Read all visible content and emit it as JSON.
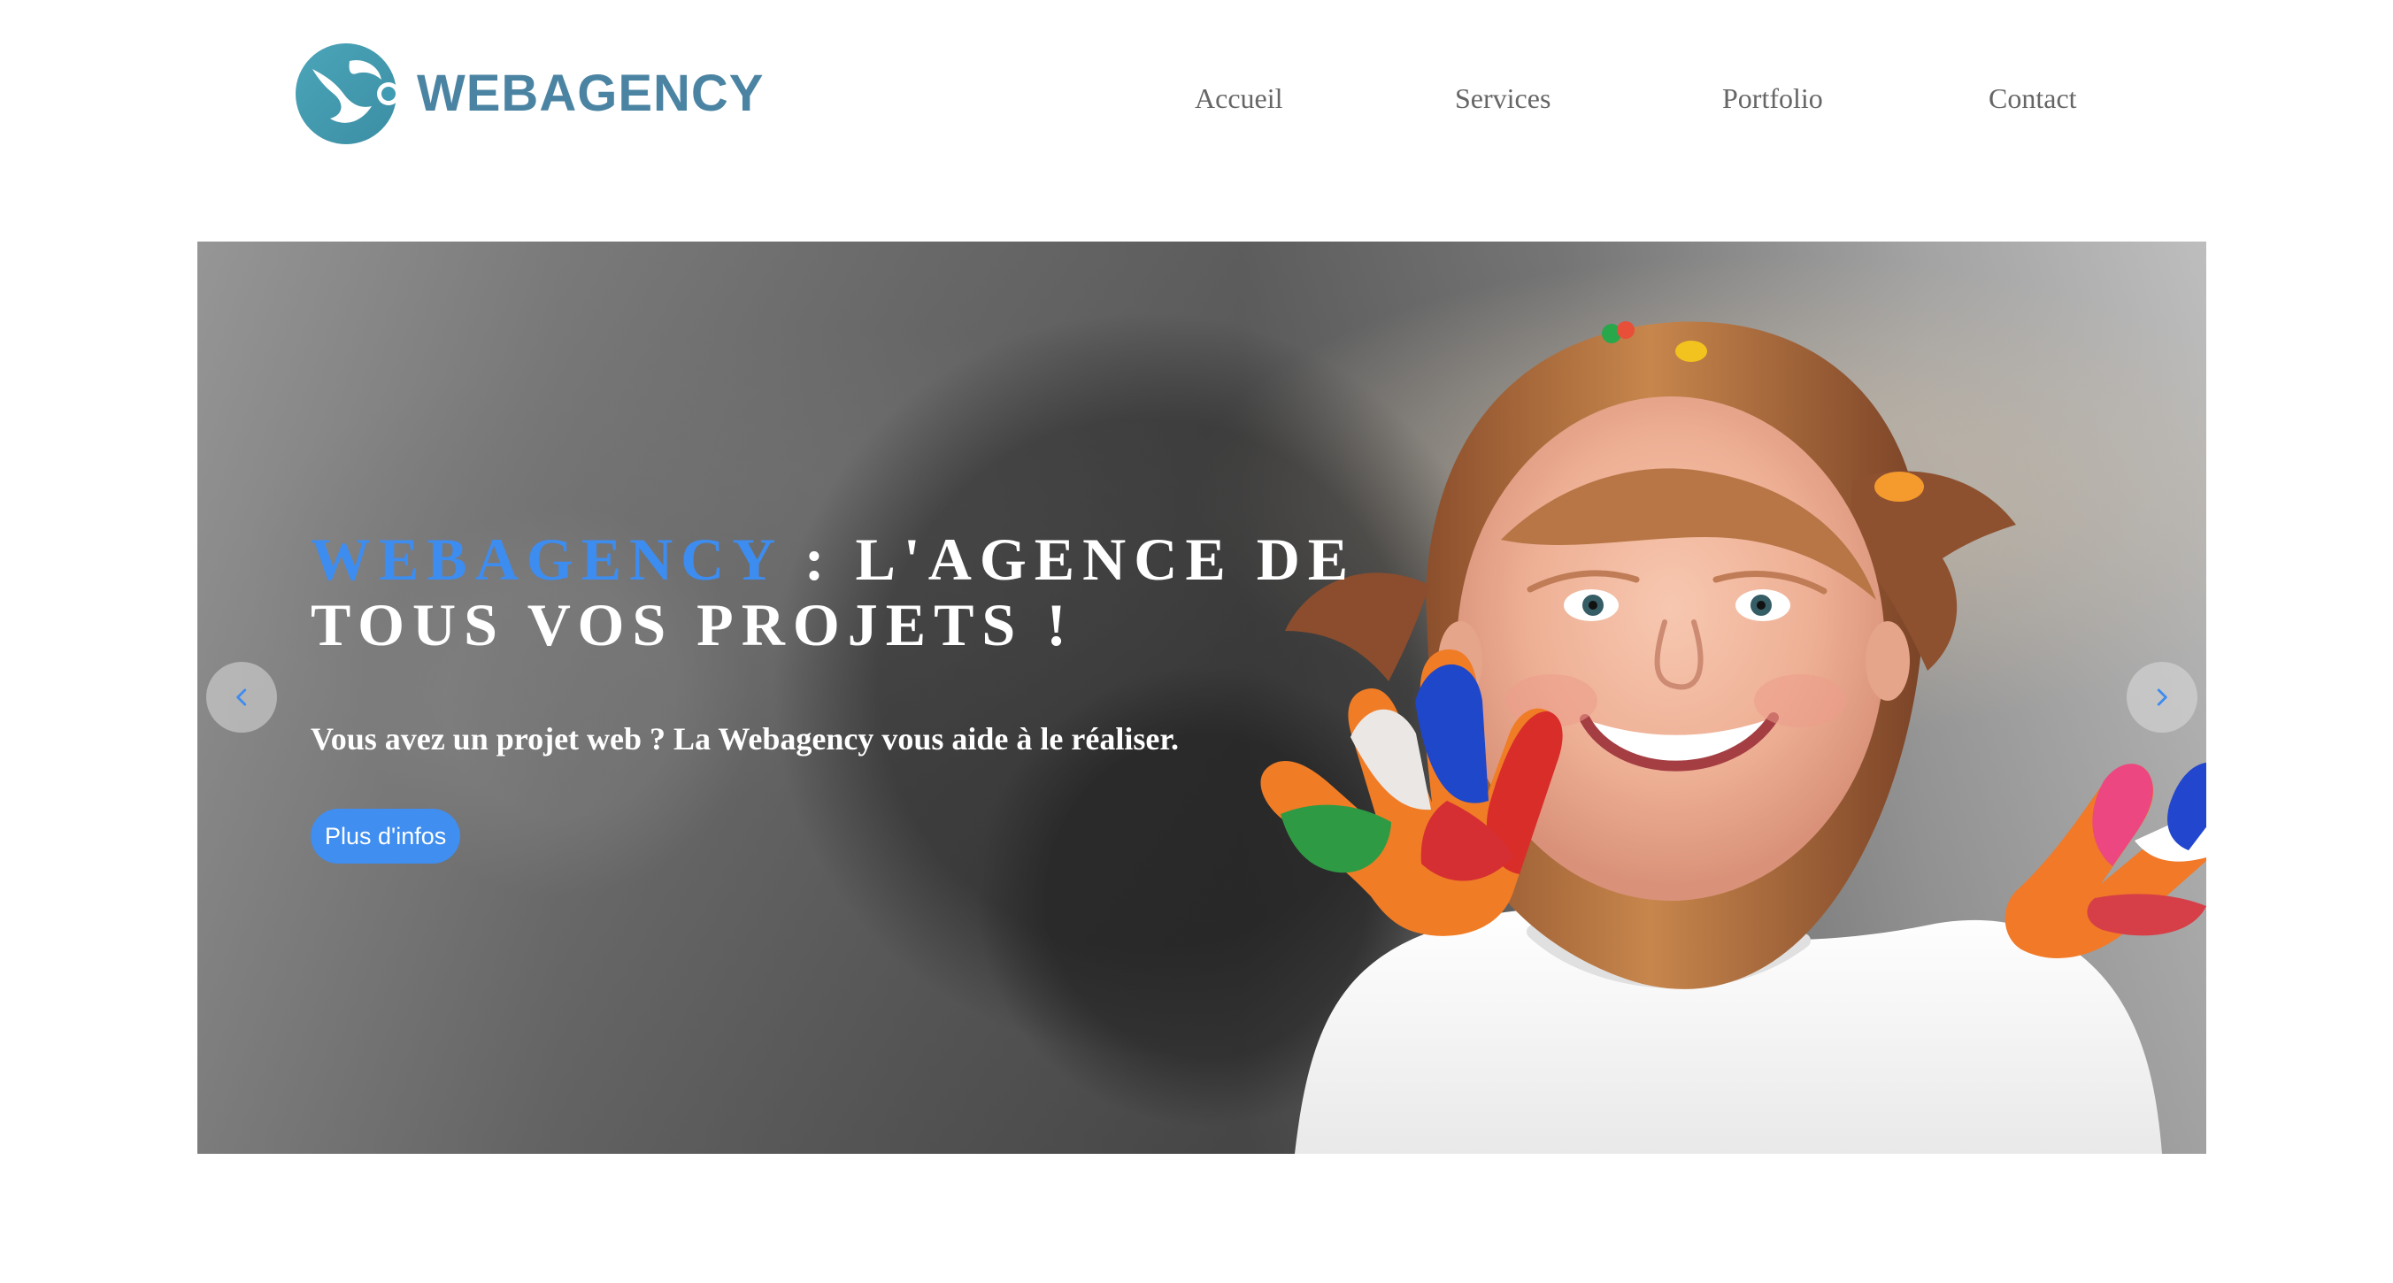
{
  "brand": {
    "name": "WEBAGENCY",
    "color": "#4b84a3"
  },
  "nav": {
    "items": [
      {
        "label": "Accueil"
      },
      {
        "label": "Services"
      },
      {
        "label": "Portfolio"
      },
      {
        "label": "Contact"
      }
    ]
  },
  "hero": {
    "title_accent": "WEBAGENCY",
    "title_rest": " : L'AGENCE DE TOUS VOS PROJETS !",
    "subtitle": "Vous avez un projet web ? La Webagency vous aide à le réaliser.",
    "button_label": "Plus d'infos",
    "accent_color": "#3d8cf0"
  },
  "icons": {
    "previous": "chevron-left-icon",
    "next": "chevron-right-icon"
  }
}
